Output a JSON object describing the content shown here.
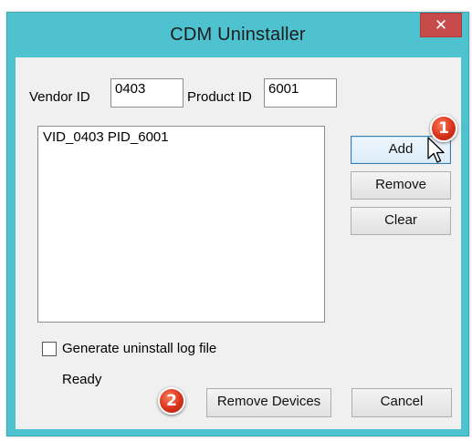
{
  "window": {
    "title": "CDM Uninstaller",
    "close_glyph": "✕",
    "accent_color": "#4fc2cf",
    "close_color": "#c74b4b"
  },
  "form": {
    "vendor_label": "Vendor ID",
    "vendor_value": "0403",
    "product_label": "Product ID",
    "product_value": "6001"
  },
  "device_list": [
    "VID_0403 PID_6001"
  ],
  "buttons": {
    "add": "Add",
    "remove": "Remove",
    "clear": "Clear",
    "remove_devices": "Remove Devices",
    "cancel": "Cancel"
  },
  "options": {
    "log_label": "Generate uninstall log file",
    "log_checked": false
  },
  "status": "Ready",
  "annotations": [
    {
      "number": "1",
      "target": "add-button",
      "color": "#d8321a"
    },
    {
      "number": "2",
      "target": "remove-devices-button",
      "color": "#d8321a"
    }
  ],
  "cursor": "arrow-pointer-icon"
}
